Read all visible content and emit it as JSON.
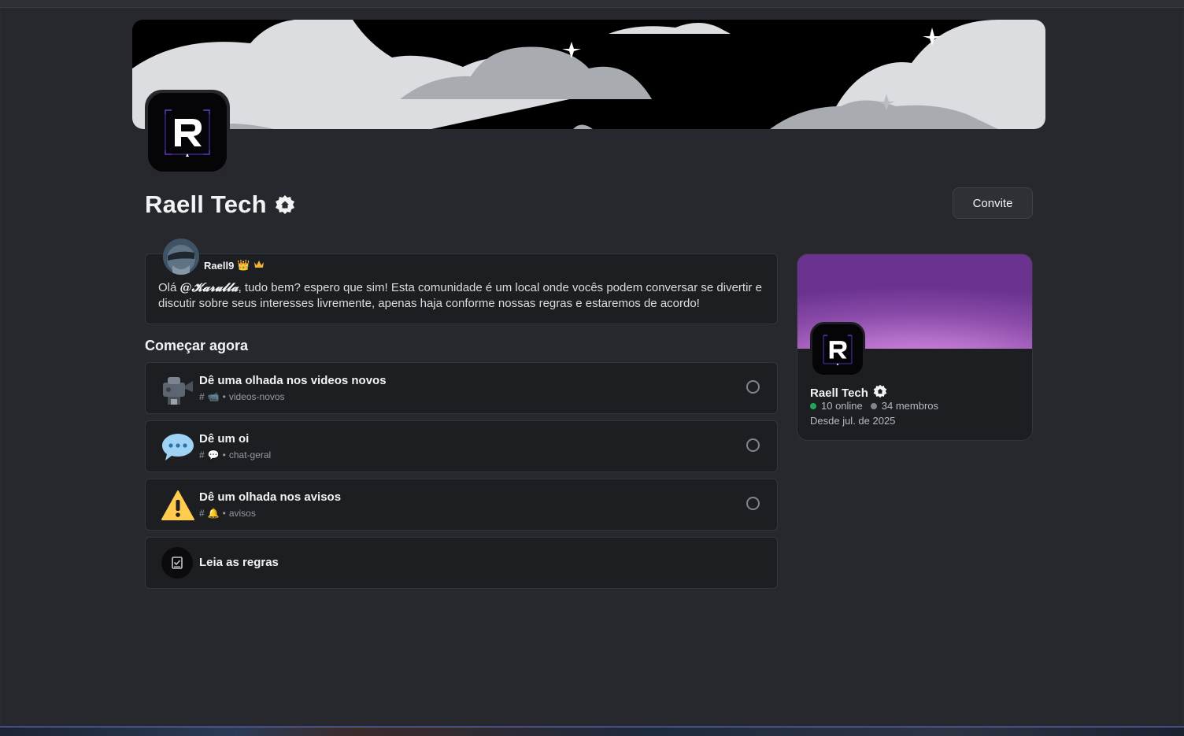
{
  "server": {
    "name": "Raell Tech",
    "invite_label": "Convite"
  },
  "welcome": {
    "author": "Raell9",
    "author_emoji": "👑",
    "message_before": "Olá ",
    "mention": "@𝓚𝓪𝓻𝓾𝓵𝓵𝓪",
    "message_after": ", tudo bem? espero que sim! Esta comunidade é um local onde vocês podem conversar se divertir e discutir sobre seus interesses livremente, apenas haja conforme nossas regras e estaremos de acordo!"
  },
  "getting_started": {
    "title": "Começar agora",
    "tasks": [
      {
        "title": "Dê uma olhada nos videos novos",
        "channel_emoji": "📹",
        "channel": "videos-novos",
        "icon": "video-camera-icon"
      },
      {
        "title": "Dê um oi",
        "channel_emoji": "💬",
        "channel": "chat-geral",
        "icon": "speech-bubble-icon"
      },
      {
        "title": "Dê um olhada nos avisos",
        "channel_emoji": "🔔",
        "channel": "avisos",
        "icon": "warning-icon"
      },
      {
        "title": "Leia as regras",
        "icon": "rules-icon"
      }
    ]
  },
  "card": {
    "name": "Raell Tech",
    "online": "10 online",
    "members": "34 membros",
    "since": "Desde jul. de 2025",
    "online_color": "#23a55a",
    "members_color": "#80848e"
  },
  "colors": {
    "background": "#27282d",
    "panel": "#1d1e22",
    "accent_purple": "#b06cc6"
  }
}
